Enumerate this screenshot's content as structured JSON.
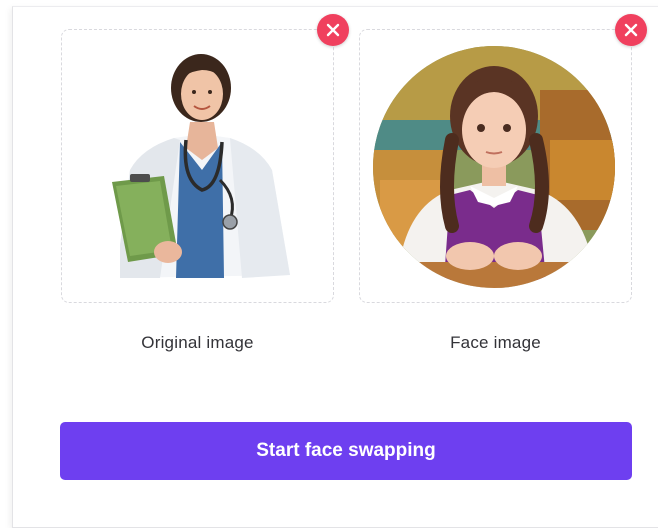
{
  "uploads": {
    "original": {
      "caption": "Original image",
      "remove_icon": "close-icon"
    },
    "face": {
      "caption": "Face image",
      "remove_icon": "close-icon"
    }
  },
  "actions": {
    "start_label": "Start face swapping"
  },
  "colors": {
    "accent": "#6e3ff0",
    "remove": "#f0405e",
    "dashed_border": "#d9d9de"
  }
}
